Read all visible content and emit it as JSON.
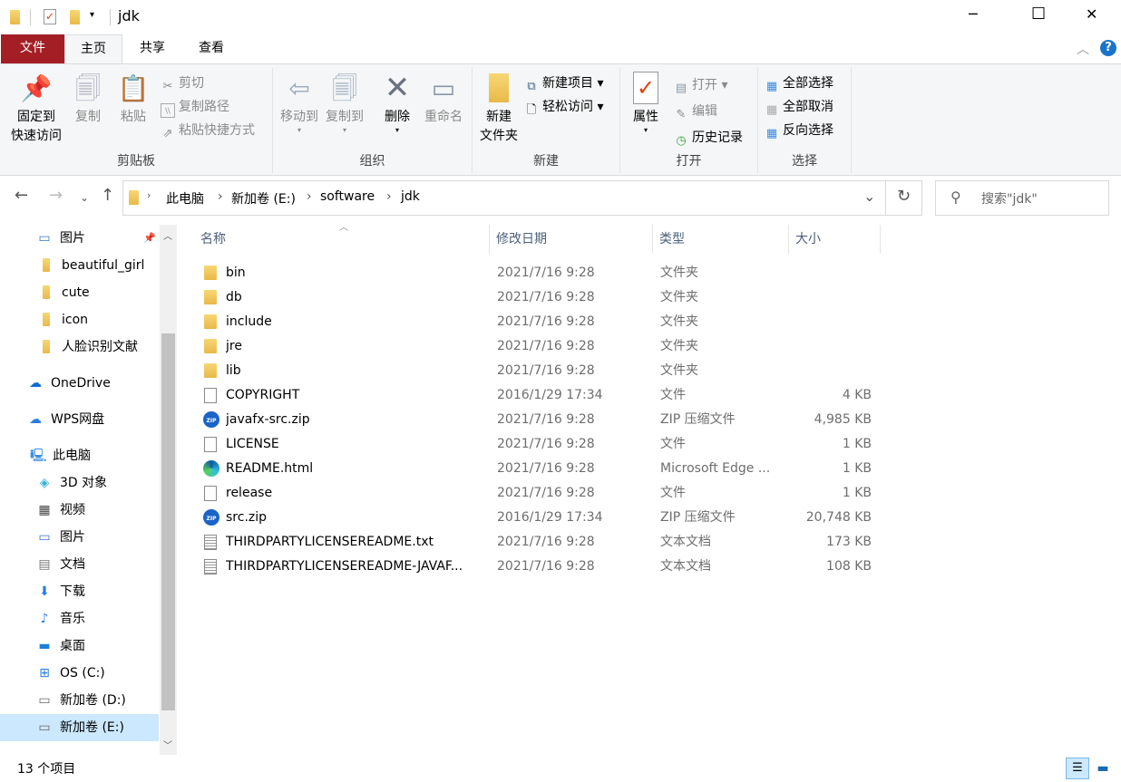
{
  "window": {
    "title": "jdk",
    "minimize": "─",
    "maximize": "☐",
    "close": "✕"
  },
  "tabs": [
    {
      "label": "文件"
    },
    {
      "label": "主页"
    },
    {
      "label": "共享"
    },
    {
      "label": "查看"
    }
  ],
  "ribbon": {
    "clipboard": {
      "label": "剪贴板",
      "pin": "固定到",
      "pin2": "快速访问",
      "copy": "复制",
      "paste": "粘贴",
      "cut": "剪切",
      "copy_path": "复制路径",
      "paste_shortcut": "粘贴快捷方式"
    },
    "organize": {
      "label": "组织",
      "move_to": "移动到",
      "copy_to": "复制到",
      "delete": "删除",
      "rename": "重命名"
    },
    "new": {
      "label": "新建",
      "new_folder": "新建",
      "new_folder2": "文件夹",
      "new_item": "新建项目",
      "easy_access": "轻松访问"
    },
    "open": {
      "label": "打开",
      "properties": "属性",
      "open": "打开",
      "edit": "编辑",
      "history": "历史记录"
    },
    "select": {
      "label": "选择",
      "select_all": "全部选择",
      "select_none": "全部取消",
      "invert": "反向选择"
    }
  },
  "address": {
    "crumbs": [
      "此电脑",
      "新加卷 (E:)",
      "software",
      "jdk"
    ]
  },
  "search": {
    "placeholder": "搜索\"jdk\""
  },
  "sidebar": [
    {
      "label": "图片",
      "icon": "pictures-icon"
    },
    {
      "label": "beautiful_girl",
      "icon": "folder-icon"
    },
    {
      "label": "cute",
      "icon": "folder-icon"
    },
    {
      "label": "icon",
      "icon": "folder-icon"
    },
    {
      "label": "人脸识别文献",
      "icon": "folder-icon"
    },
    {
      "label": "OneDrive",
      "icon": "onedrive-icon"
    },
    {
      "label": "WPS网盘",
      "icon": "cloud-icon"
    },
    {
      "label": "此电脑",
      "icon": "computer-icon"
    },
    {
      "label": "3D 对象",
      "icon": "3d-objects-icon"
    },
    {
      "label": "视频",
      "icon": "video-icon"
    },
    {
      "label": "图片",
      "icon": "pictures-icon"
    },
    {
      "label": "文档",
      "icon": "documents-icon"
    },
    {
      "label": "下载",
      "icon": "download-icon"
    },
    {
      "label": "音乐",
      "icon": "music-icon"
    },
    {
      "label": "桌面",
      "icon": "desktop-icon"
    },
    {
      "label": "OS (C:)",
      "icon": "windows-drive-icon"
    },
    {
      "label": "新加卷 (D:)",
      "icon": "drive-icon"
    },
    {
      "label": "新加卷 (E:)",
      "icon": "drive-icon",
      "selected": true
    }
  ],
  "columns": {
    "name": "名称",
    "date": "修改日期",
    "type": "类型",
    "size": "大小"
  },
  "files": [
    {
      "name": "bin",
      "date": "2021/7/16 9:28",
      "type": "文件夹",
      "size": "",
      "icon": "folder"
    },
    {
      "name": "db",
      "date": "2021/7/16 9:28",
      "type": "文件夹",
      "size": "",
      "icon": "folder"
    },
    {
      "name": "include",
      "date": "2021/7/16 9:28",
      "type": "文件夹",
      "size": "",
      "icon": "folder"
    },
    {
      "name": "jre",
      "date": "2021/7/16 9:28",
      "type": "文件夹",
      "size": "",
      "icon": "folder"
    },
    {
      "name": "lib",
      "date": "2021/7/16 9:28",
      "type": "文件夹",
      "size": "",
      "icon": "folder"
    },
    {
      "name": "COPYRIGHT",
      "date": "2016/1/29 17:34",
      "type": "文件",
      "size": "4 KB",
      "icon": "file"
    },
    {
      "name": "javafx-src.zip",
      "date": "2021/7/16 9:28",
      "type": "ZIP 压缩文件",
      "size": "4,985 KB",
      "icon": "zip"
    },
    {
      "name": "LICENSE",
      "date": "2021/7/16 9:28",
      "type": "文件",
      "size": "1 KB",
      "icon": "file"
    },
    {
      "name": "README.html",
      "date": "2021/7/16 9:28",
      "type": "Microsoft Edge ...",
      "size": "1 KB",
      "icon": "edge"
    },
    {
      "name": "release",
      "date": "2021/7/16 9:28",
      "type": "文件",
      "size": "1 KB",
      "icon": "file"
    },
    {
      "name": "src.zip",
      "date": "2016/1/29 17:34",
      "type": "ZIP 压缩文件",
      "size": "20,748 KB",
      "icon": "zip"
    },
    {
      "name": "THIRDPARTYLICENSEREADME.txt",
      "date": "2021/7/16 9:28",
      "type": "文本文档",
      "size": "173 KB",
      "icon": "text"
    },
    {
      "name": "THIRDPARTYLICENSEREADME-JAVAF...",
      "date": "2021/7/16 9:28",
      "type": "文本文档",
      "size": "108 KB",
      "icon": "text"
    }
  ],
  "status": {
    "count": "13 个项目"
  },
  "colors": {
    "file_tab": "#a31f25",
    "accent": "#0078d7",
    "selected": "#cce8ff"
  }
}
